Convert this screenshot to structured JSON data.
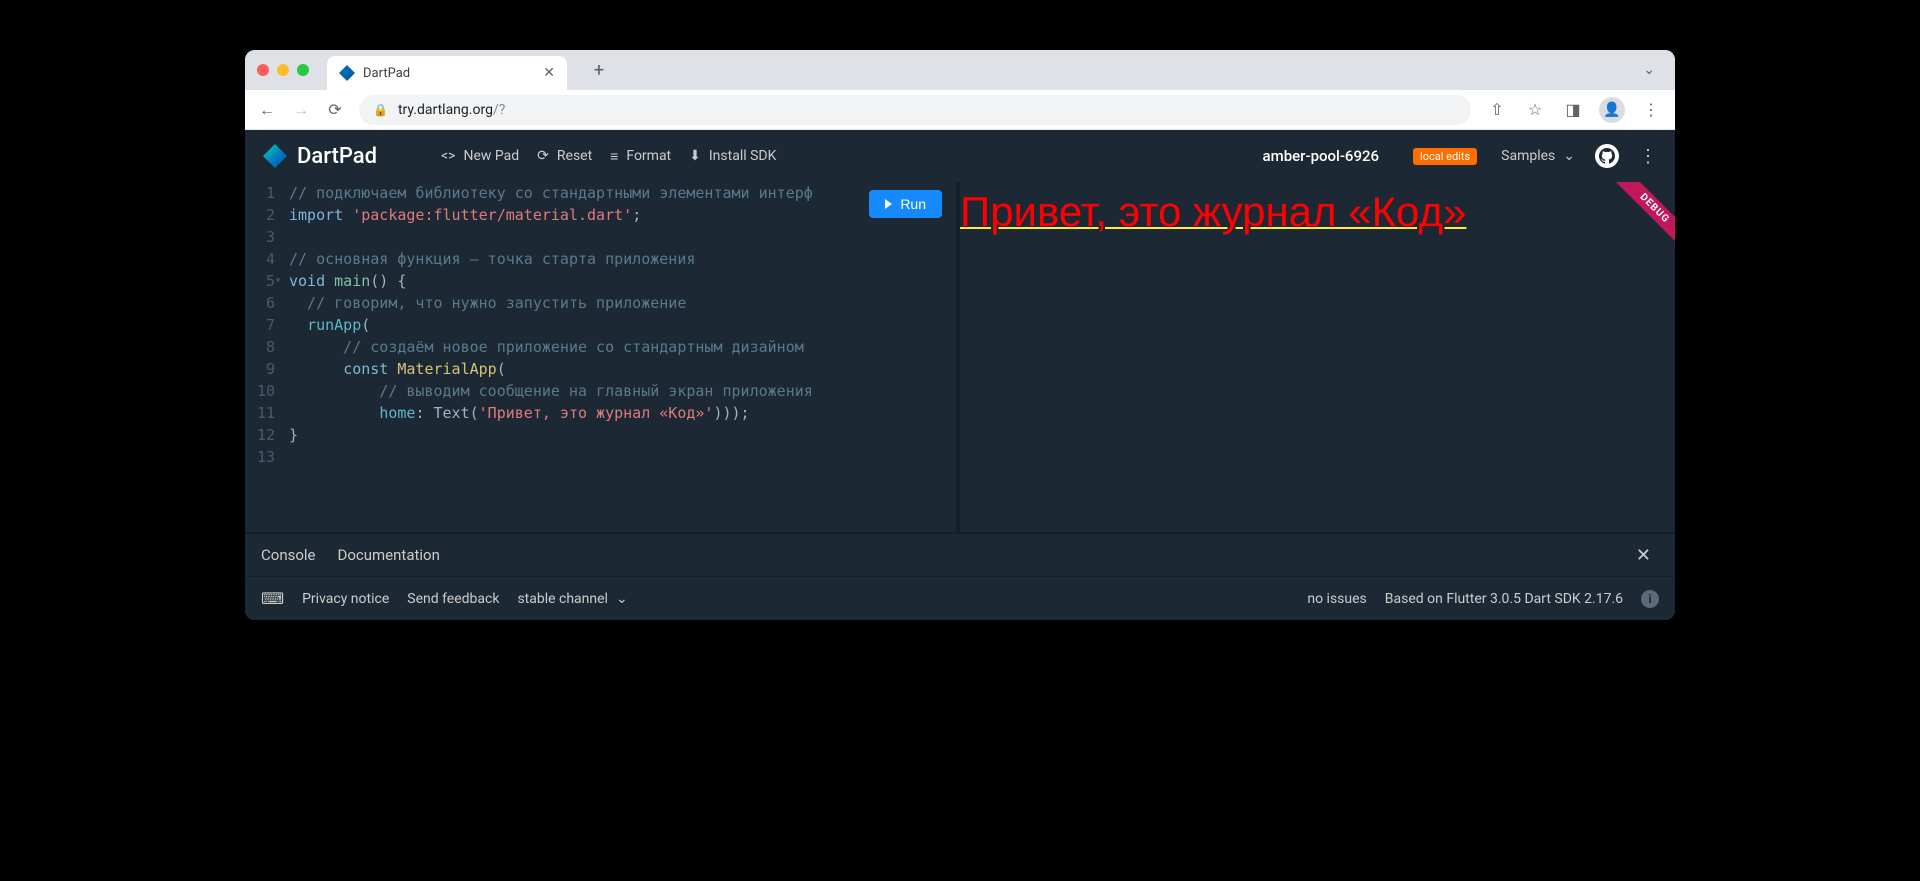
{
  "browser": {
    "tab_title": "DartPad",
    "url_host": "try.dartlang.org",
    "url_path": "/?"
  },
  "toolbar": {
    "brand": "DartPad",
    "new_pad": "New Pad",
    "reset": "Reset",
    "format": "Format",
    "install_sdk": "Install SDK",
    "run": "Run"
  },
  "project": {
    "name": "amber-pool-6926",
    "badge": "local edits"
  },
  "right": {
    "samples": "Samples"
  },
  "code": {
    "lines": [
      "1",
      "2",
      "3",
      "4",
      "5",
      "6",
      "7",
      "8",
      "9",
      "10",
      "11",
      "12",
      "13"
    ]
  },
  "src": {
    "l1": "// подключаем библиотеку со стандартными элементами интерф",
    "l2a": "import",
    "l2b": "'package:flutter/material.dart'",
    "l2c": ";",
    "l4": "// основная функция — точка старта приложения",
    "l5a": "void",
    "l5b": "main",
    "l5c": "() {",
    "l6": "  // говорим, что нужно запустить приложение",
    "l7a": "  ",
    "l7b": "runApp",
    "l7c": "(",
    "l8": "      // создаём новое приложение со стандартным дизайном",
    "l9a": "      ",
    "l9b": "const",
    "l9c": "MaterialApp",
    "l9d": "(",
    "l10": "          // выводим сообщение на главный экран приложения",
    "l11a": "          ",
    "l11b": "home",
    "l11c": ": Text(",
    "l11d": "'Привет, это журнал «Код»'",
    "l11e": ")));",
    "l12": "}"
  },
  "preview": {
    "text": "Привет, это журнал «Код»",
    "debug": "DEBUG"
  },
  "console": {
    "console": "Console",
    "documentation": "Documentation"
  },
  "status": {
    "privacy": "Privacy notice",
    "feedback": "Send feedback",
    "channel": "stable channel",
    "issues": "no issues",
    "sdk": "Based on Flutter 3.0.5 Dart SDK 2.17.6"
  }
}
